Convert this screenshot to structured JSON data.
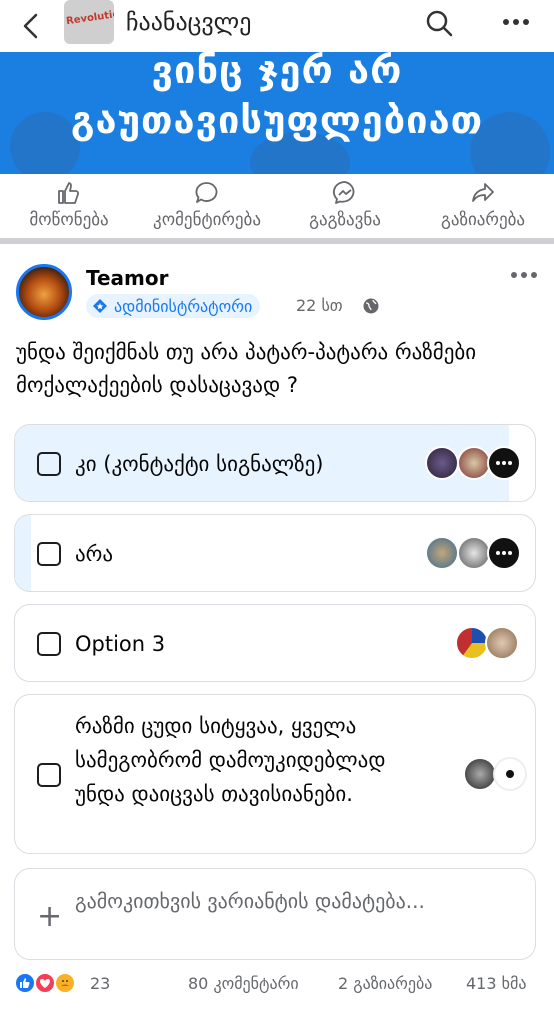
{
  "topbar": {
    "group_name": "ჩაანაცვლე",
    "thumb_label": "Revolution"
  },
  "banner": {
    "line1": "ვინც ჯერ არ",
    "line2": "გაუთავისუფლებიათ",
    "color": "#1a7fe0"
  },
  "actions": [
    {
      "label": "მოწონება",
      "icon": "thumbs-up-icon"
    },
    {
      "label": "კომენტირება",
      "icon": "comment-icon"
    },
    {
      "label": "გაგზავნა",
      "icon": "messenger-icon"
    },
    {
      "label": "გაზიარება",
      "icon": "share-icon"
    }
  ],
  "post": {
    "author": "Teamor",
    "badge": "ადმინისტრატორი",
    "time": "22 სთ",
    "question": "უნდა შეიქმნას თუ არა პატარ-პატარა რაზმები მოქალაქეების დასაცავად ?"
  },
  "poll": {
    "options": [
      {
        "text": "კი (კონტაქტი სიგნალზე)",
        "fill_fraction": 0.95,
        "voters": 3
      },
      {
        "text": "არა",
        "fill_fraction": 0.03,
        "voters": 3
      },
      {
        "text": "Option 3",
        "fill_fraction": 0.0,
        "voters": 2
      },
      {
        "text": "რაზმი ცუდი სიტყვაა, ყველა სამეგობრომ დამოუკიდებლად უნდა დაიცვას თავისიანები.",
        "fill_fraction": 0.0,
        "voters": 2
      }
    ],
    "add_option": "გამოკითხვის ვარიანტის დამატება..."
  },
  "stats": {
    "reactions_count": "23",
    "comments": "80 კომენტარი",
    "shares": "2 გაზიარება",
    "views": "413 ხმა"
  },
  "colors": {
    "accent": "#1877f2",
    "poll_fill": "#e7f3ff",
    "muted": "#65676b"
  }
}
